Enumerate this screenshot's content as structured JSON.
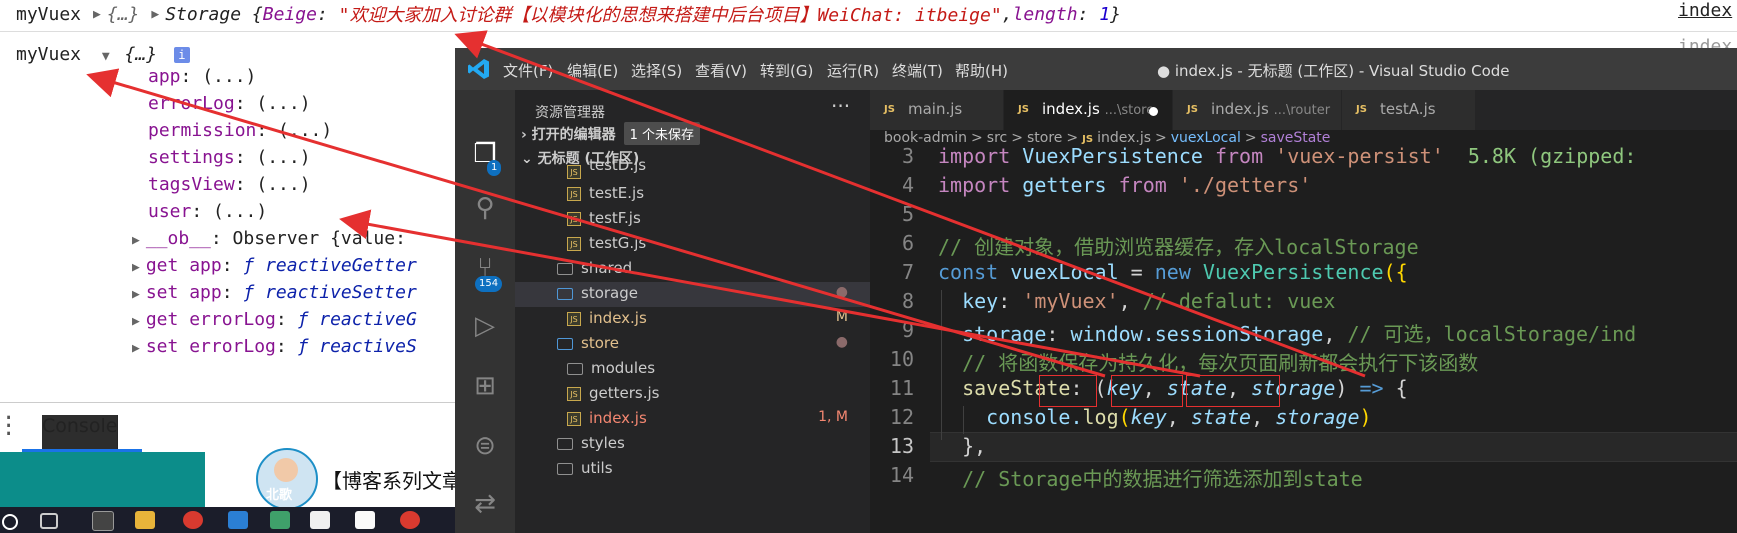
{
  "console": {
    "line1": {
      "name": "myVuex",
      "obj": "{…}",
      "storage_label": "Storage",
      "open": "{",
      "key": "Beige",
      "value": "\"欢迎大家加入讨论群【以模块化的思想来搭建中后台项目】WeiChat: itbeige\"",
      "comma": ", ",
      "length_key": "length",
      "length_val": "1",
      "close": "}"
    },
    "right_link": "index",
    "right_link2": "index",
    "obj_name": "myVuex",
    "obj_summary": "{…}",
    "info_icon": "i",
    "props": [
      {
        "key": "app",
        "value": ": (...)"
      },
      {
        "key": "errorLog",
        "value": ": (...)"
      },
      {
        "key": "permission",
        "value": ": (...)"
      },
      {
        "key": "settings",
        "value": ": (...)"
      },
      {
        "key": "tagsView",
        "value": ": (...)"
      },
      {
        "key": "user",
        "value": ": (...)"
      }
    ],
    "subprops": [
      {
        "prefix": "",
        "key": "__ob__",
        "rest": ": Observer {value: "
      },
      {
        "prefix": "get ",
        "key": "app",
        "rest": ": ",
        "f": "ƒ reactiveGetter"
      },
      {
        "prefix": "set ",
        "key": "app",
        "rest": ": ",
        "f": "ƒ reactiveSetter"
      },
      {
        "prefix": "get ",
        "key": "errorLog",
        "rest": ": ",
        "f": "ƒ reactiveG"
      },
      {
        "prefix": "set ",
        "key": "errorLog",
        "rest": ": ",
        "f": "ƒ reactiveS"
      }
    ],
    "tab_label": "Console"
  },
  "banner": {
    "avatar_text": "北歌",
    "text": "【博客系列文章"
  },
  "vscode": {
    "menus": [
      "文件(F)",
      "编辑(E)",
      "选择(S)",
      "查看(V)",
      "转到(G)",
      "运行(R)",
      "终端(T)",
      "帮助(H)"
    ],
    "window_title": "● index.js - 无标题 (工作区) - Visual Studio Code",
    "explorer_title": "资源管理器",
    "more": "···",
    "open_editors": "打开的编辑器",
    "unsaved_badge": "1 个未保存",
    "workspace": "无标题 (工作区)",
    "explorer_badge": "1",
    "scm_badge": "154",
    "tree": [
      {
        "label": "testD.js",
        "type": "js",
        "status": ""
      },
      {
        "label": "testE.js",
        "type": "js",
        "status": ""
      },
      {
        "label": "testF.js",
        "type": "js",
        "status": ""
      },
      {
        "label": "testG.js",
        "type": "js",
        "status": ""
      },
      {
        "label": "shared",
        "type": "folder",
        "status": ""
      },
      {
        "label": "storage",
        "type": "folder-open",
        "status": "●"
      },
      {
        "label": "index.js",
        "type": "js",
        "status": "M"
      },
      {
        "label": "store",
        "type": "folder-open",
        "status": "●"
      },
      {
        "label": "modules",
        "type": "folder",
        "status": ""
      },
      {
        "label": "getters.js",
        "type": "js",
        "status": ""
      },
      {
        "label": "index.js",
        "type": "js",
        "status": "1, M"
      },
      {
        "label": "styles",
        "type": "folder",
        "status": ""
      },
      {
        "label": "utils",
        "type": "folder",
        "status": ""
      }
    ],
    "tabs": [
      {
        "name": "main.js",
        "sub": ""
      },
      {
        "name": "index.js",
        "sub": "...\\store"
      },
      {
        "name": "index.js",
        "sub": "...\\router"
      },
      {
        "name": "testA.js",
        "sub": ""
      }
    ],
    "breadcrumbs": [
      "book-admin",
      ">",
      "src",
      ">",
      "store",
      ">",
      "JS",
      "index.js",
      ">",
      "vuexLocal",
      ">",
      "saveState"
    ],
    "line_numbers": [
      "3",
      "4",
      "5",
      "6",
      "7",
      "8",
      "9",
      "10",
      "11",
      "12",
      "13",
      "14"
    ],
    "code": {
      "l3_kw": "import",
      "l3_var": " VuexPersistence ",
      "l3_from": "from",
      "l3_str": " 'vuex-persist'",
      "l3_hint": "  5.8K (gzipped:",
      "l4_kw": "import",
      "l4_var": " getters ",
      "l4_from": "from",
      "l4_str": " './getters'",
      "l6_cm": "// 创建对象，借助浏览器缓存，存入localStorage",
      "l7_const": "const",
      "l7_var": " vuexLocal ",
      "l7_eq": "= ",
      "l7_new": "new",
      "l7_cls": " VuexPersistence",
      "l7_paren": "({",
      "l8_key": "  key",
      "l8_colon": ": ",
      "l8_str": "'myVuex'",
      "l8_rest": ", ",
      "l8_cm": "// defalut: vuex",
      "l9_key": "  storage",
      "l9_colon": ": ",
      "l9_val": "window.sessionStorage",
      "l9_rest": ", ",
      "l9_cm": "// 可选，localStorage/ind",
      "l10_cm": "  // 将函数保存为持久化，每次页面刷新都会执行下该函数",
      "l11_key": "  saveState",
      "l11_colon": ": (",
      "l11_p1": "key",
      "l11_c1": ", ",
      "l11_p2": "state",
      "l11_c2": ", ",
      "l11_p3": "storage",
      "l11_close": ") ",
      "l11_arrow": "=>",
      "l11_brace": " {",
      "l12_pre": "    console.",
      "l12_fn": "log",
      "l12_open": "(",
      "l12_p1": "key",
      "l12_c1": ", ",
      "l12_p2": "state",
      "l12_c2": ", ",
      "l12_p3": "storage",
      "l12_close": ")",
      "l13": "  },",
      "l14_cm": "  // Storage中的数据进行筛选添加到state"
    }
  },
  "colors": {
    "annotation": "#e53030",
    "vscode_bg": "#1e1e1e",
    "teal": "#0c8d8a"
  }
}
